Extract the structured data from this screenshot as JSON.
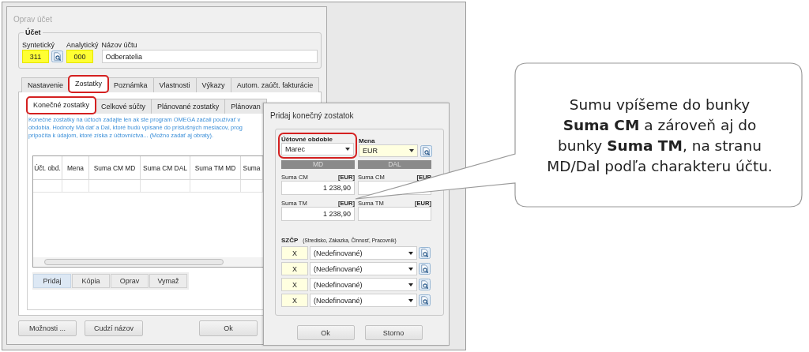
{
  "main_window": {
    "title": "Oprav účet",
    "account_group": {
      "title": "Účet",
      "fields": [
        {
          "kind": "code",
          "label": "Syntetický",
          "value": "311",
          "lookup": true
        },
        {
          "kind": "code",
          "label": "Analytický",
          "value": "000",
          "lookup": false
        },
        {
          "kind": "name",
          "label": "Názov účtu",
          "value": "Odberatelia",
          "lookup": false
        }
      ]
    },
    "tabs": [
      {
        "label": "Nastavenie",
        "selected": false,
        "highlighted": false
      },
      {
        "label": "Zostatky",
        "selected": true,
        "highlighted": true
      },
      {
        "label": "Poznámka",
        "selected": false,
        "highlighted": false
      },
      {
        "label": "Vlastnosti",
        "selected": false,
        "highlighted": false
      },
      {
        "label": "Výkazy",
        "selected": false,
        "highlighted": false
      },
      {
        "label": "Autom. zaúčt. fakturácie",
        "selected": false,
        "highlighted": false
      }
    ],
    "subtabs": [
      {
        "label": "Konečné zostatky",
        "selected": true,
        "highlighted": true
      },
      {
        "label": "Celkové súčty",
        "selected": false,
        "highlighted": false
      },
      {
        "label": "Plánované zostatky",
        "selected": false,
        "highlighted": false
      },
      {
        "label": "Plánovan",
        "selected": false,
        "highlighted": false
      }
    ],
    "info_lines": [
      "Konečné zostatky na účtoch zadajte len ak ste program OMEGA začali používať v",
      "obdobia. Hodnoty Má dať a Dal, ktoré budú vpísané do príslušných mesiacov, prog",
      "pripočíta k údajom, ktoré získa z účtovníctva... (Možno zadať aj obraty)."
    ],
    "table": {
      "columns": [
        "Účt. obd.",
        "Mena",
        "Suma CM MD",
        "Suma CM DAL",
        "Suma TM MD",
        "Suma"
      ]
    },
    "table_buttons": [
      {
        "label": "Pridaj",
        "selected": true
      },
      {
        "label": "Kópia",
        "selected": false
      },
      {
        "label": "Oprav",
        "selected": false
      },
      {
        "label": "Vymaž",
        "selected": false
      }
    ],
    "buttons": [
      "Možnosti ...",
      "Cudzí názov",
      "Ok"
    ]
  },
  "dialog": {
    "title": "Pridaj konečný zostatok",
    "period": {
      "label": "Účtovné obdobie",
      "value": "Marec",
      "highlighted": true
    },
    "currency": {
      "label": "Mena",
      "value": "EUR"
    },
    "sides": [
      {
        "header": "MD",
        "fields": [
          {
            "label": "Suma CM",
            "unit": "[EUR]",
            "value": "1 238,90"
          },
          {
            "label": "Suma TM",
            "unit": "[EUR]",
            "value": "1 238,90"
          }
        ]
      },
      {
        "header": "DAL",
        "fields": [
          {
            "label": "Suma CM",
            "unit": "[EUR"
          },
          {
            "label": "Suma TM",
            "unit": "[EUR]"
          }
        ]
      }
    ],
    "szcp": {
      "label": "SZČP",
      "hint": "(Stredisko, Zákazka, Činnosť, Pracovník)",
      "rows": [
        {
          "code": "X",
          "value": "(Nedefinované)"
        },
        {
          "code": "X",
          "value": "(Nedefinované)"
        },
        {
          "code": "X",
          "value": "(Nedefinované)"
        },
        {
          "code": "X",
          "value": "(Nedefinované)"
        }
      ]
    },
    "buttons": [
      "Ok",
      "Storno"
    ]
  },
  "callout": {
    "text": "Sumu vpíšeme do bunky **Suma CM** a zároveň aj do bunky **Suma TM**, na stranu MD/Dal podľa charakteru účtu."
  }
}
